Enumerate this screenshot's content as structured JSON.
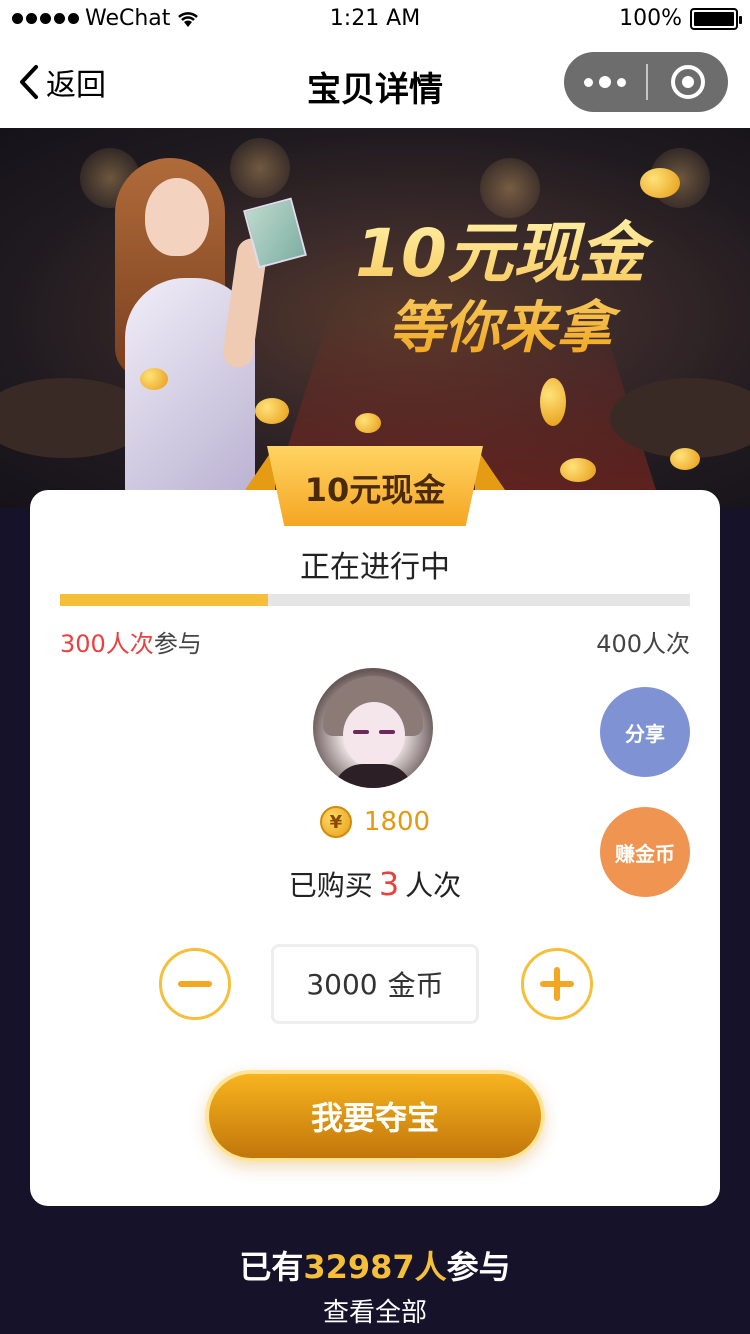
{
  "status_bar": {
    "carrier": "WeChat",
    "time": "1:21 AM",
    "battery": "100%"
  },
  "nav": {
    "back_label": "返回",
    "title": "宝贝详情"
  },
  "banner": {
    "line1": "10元现金",
    "line2": "等你来拿"
  },
  "prize": {
    "ribbon_label": "10元现金",
    "status": "正在进行中"
  },
  "progress": {
    "joined_count": "300人次",
    "joined_suffix": "参与",
    "total": "400人次",
    "fraction": 0.33
  },
  "user": {
    "coins": "1800",
    "bought_prefix": "已购买",
    "bought_count": "3",
    "bought_suffix": "人次"
  },
  "side_buttons": {
    "share": "分享",
    "earn": "赚金币"
  },
  "stepper": {
    "amount": "3000",
    "unit": "金币"
  },
  "cta": {
    "label": "我要夺宝"
  },
  "footer": {
    "prefix": "已有",
    "count": "32987人",
    "suffix": "参与",
    "view_all": "查看全部"
  }
}
